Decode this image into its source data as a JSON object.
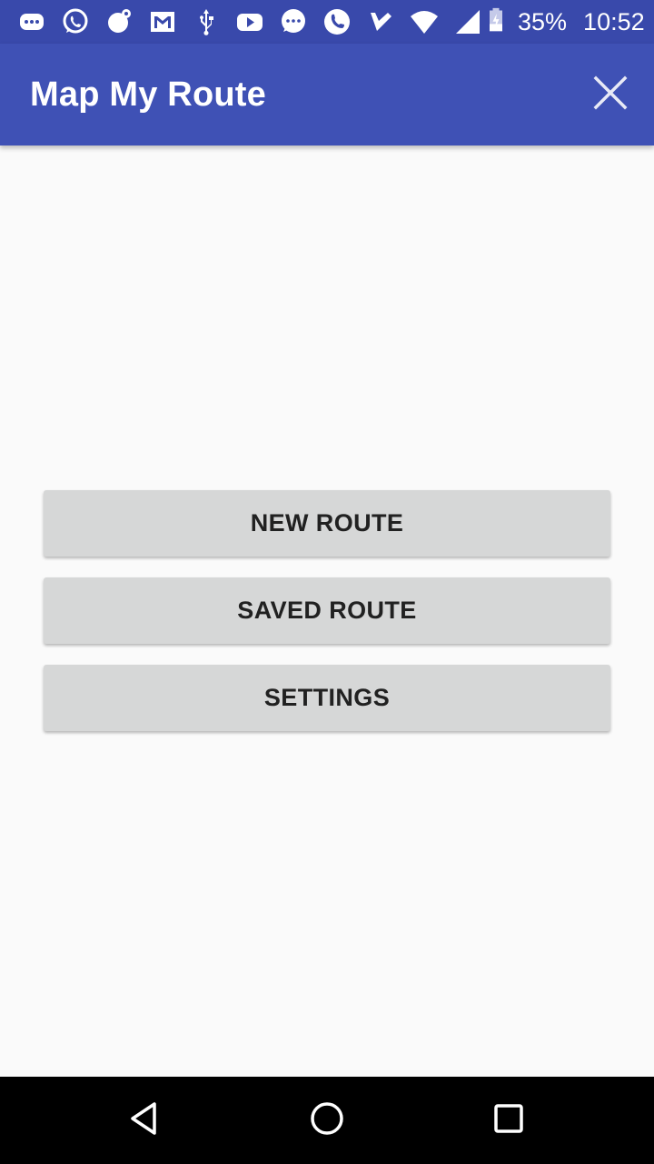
{
  "status_bar": {
    "icons": [
      "messages-icon",
      "whatsapp-icon",
      "chat-bubble-icon",
      "gmail-icon",
      "usb-icon",
      "youtube-icon",
      "sms-icon",
      "phone-icon",
      "tick-icon",
      "wifi-icon",
      "signal-icon",
      "battery-charging-icon"
    ],
    "battery": "35%",
    "time": "10:52"
  },
  "app_bar": {
    "title": "Map My Route",
    "close_icon": "close-icon"
  },
  "buttons": {
    "new_route": "NEW ROUTE",
    "saved_route": "SAVED ROUTE",
    "settings": "SETTINGS"
  },
  "nav_bar": {
    "icons": [
      "back-icon",
      "home-icon",
      "recents-icon"
    ]
  },
  "colors": {
    "status_bar": "#3949ab",
    "app_bar": "#3f51b5",
    "background": "#fafafa",
    "button": "#d6d7d7",
    "button_text": "#212121",
    "nav_bar": "#000000"
  }
}
